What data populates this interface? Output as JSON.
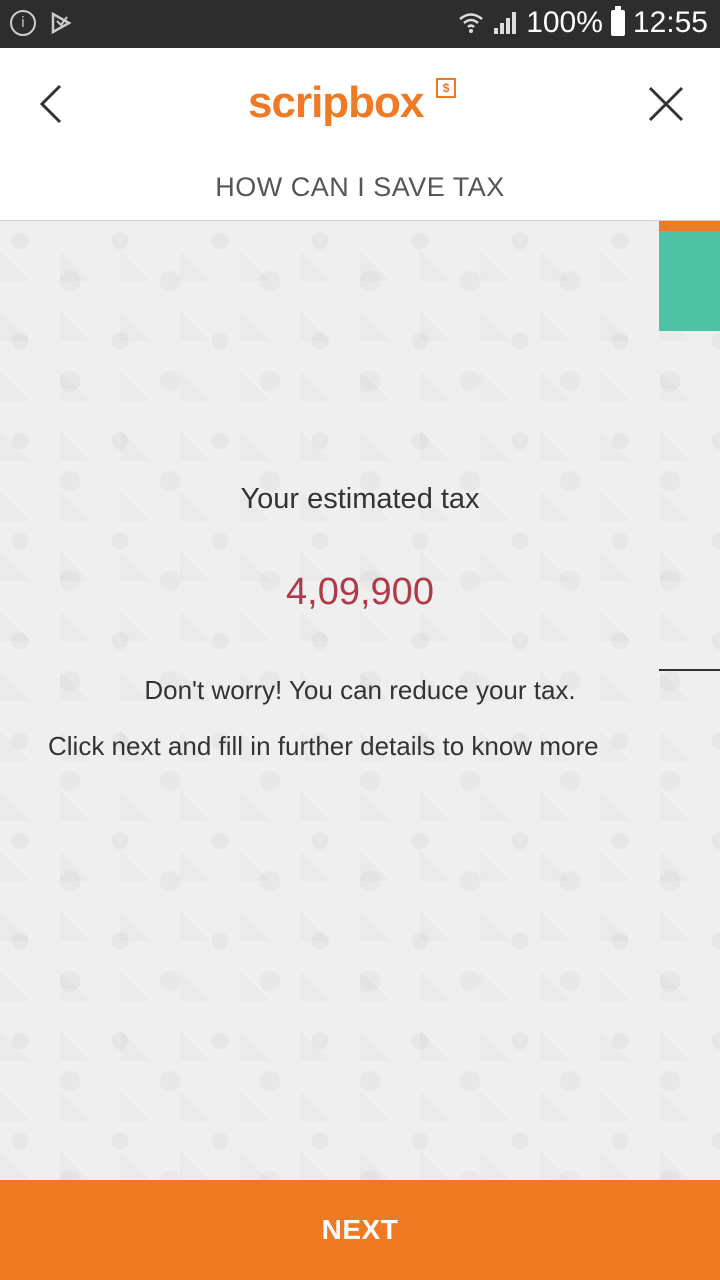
{
  "status_bar": {
    "info_icon": "info-icon",
    "play_icon": "play-store-icon",
    "battery_text": "100%",
    "time": "12:55",
    "wifi_icon": "wifi-icon",
    "signal_icon": "signal-icon",
    "battery_icon": "battery-icon"
  },
  "header": {
    "logo_text": "scripbox",
    "logo_badge": "$",
    "title": "HOW CAN I SAVE TAX",
    "back_icon": "back-arrow-icon",
    "close_icon": "close-icon"
  },
  "main": {
    "estimate_label": "Your estimated tax",
    "estimate_value": "4,09,900",
    "reassure_text": "Don't worry! You can reduce your tax.",
    "instruction_text": "Click next and fill in further details to know more"
  },
  "footer": {
    "next_label": "NEXT"
  },
  "colors": {
    "brand_orange": "#f07a23",
    "accent_green": "#4ec3a4",
    "value_red": "#b03a48"
  }
}
